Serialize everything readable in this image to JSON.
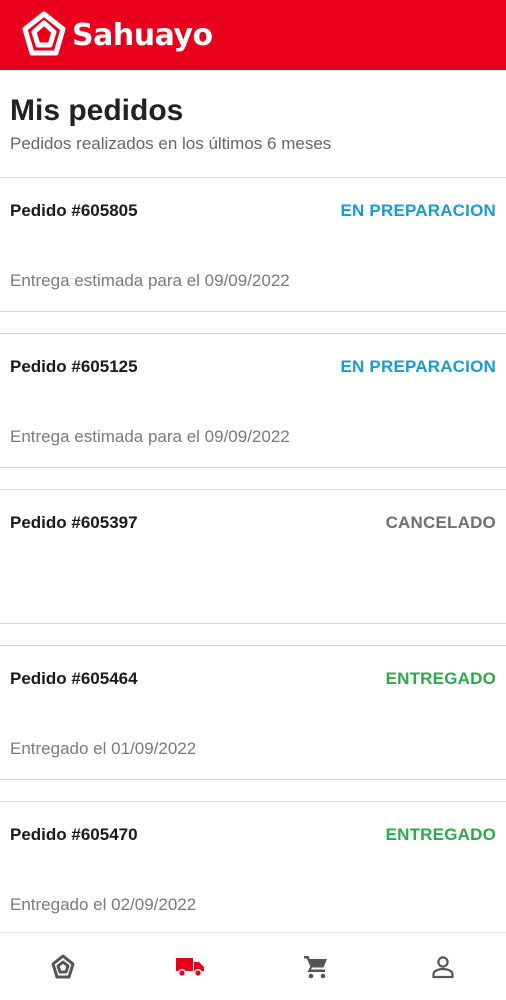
{
  "app": {
    "brand_name": "Sahuayo",
    "brand_color": "#e8001c"
  },
  "page": {
    "title": "Mis pedidos",
    "subtitle": "Pedidos realizados en los últimos 6 meses"
  },
  "status_colors": {
    "preparacion": "#1a9bd0",
    "cancelado": "#707070",
    "entregado": "#2ea84a"
  },
  "orders": [
    {
      "id_label": "Pedido #605805",
      "status": "EN PREPARACION",
      "note": "Entrega estimada para el 09/09/2022"
    },
    {
      "id_label": "Pedido #605125",
      "status": "EN PREPARACION",
      "note": "Entrega estimada para el 09/09/2022"
    },
    {
      "id_label": "Pedido #605397",
      "status": "CANCELADO",
      "note": ""
    },
    {
      "id_label": "Pedido #605464",
      "status": "ENTREGADO",
      "note": "Entregado el 01/09/2022"
    },
    {
      "id_label": "Pedido #605470",
      "status": "ENTREGADO",
      "note": "Entregado el 02/09/2022"
    }
  ],
  "bottom_nav": [
    {
      "icon": "sahuayo-logo-icon",
      "active": false
    },
    {
      "icon": "truck-icon",
      "active": true
    },
    {
      "icon": "cart-icon",
      "active": false
    },
    {
      "icon": "profile-icon",
      "active": false
    }
  ]
}
